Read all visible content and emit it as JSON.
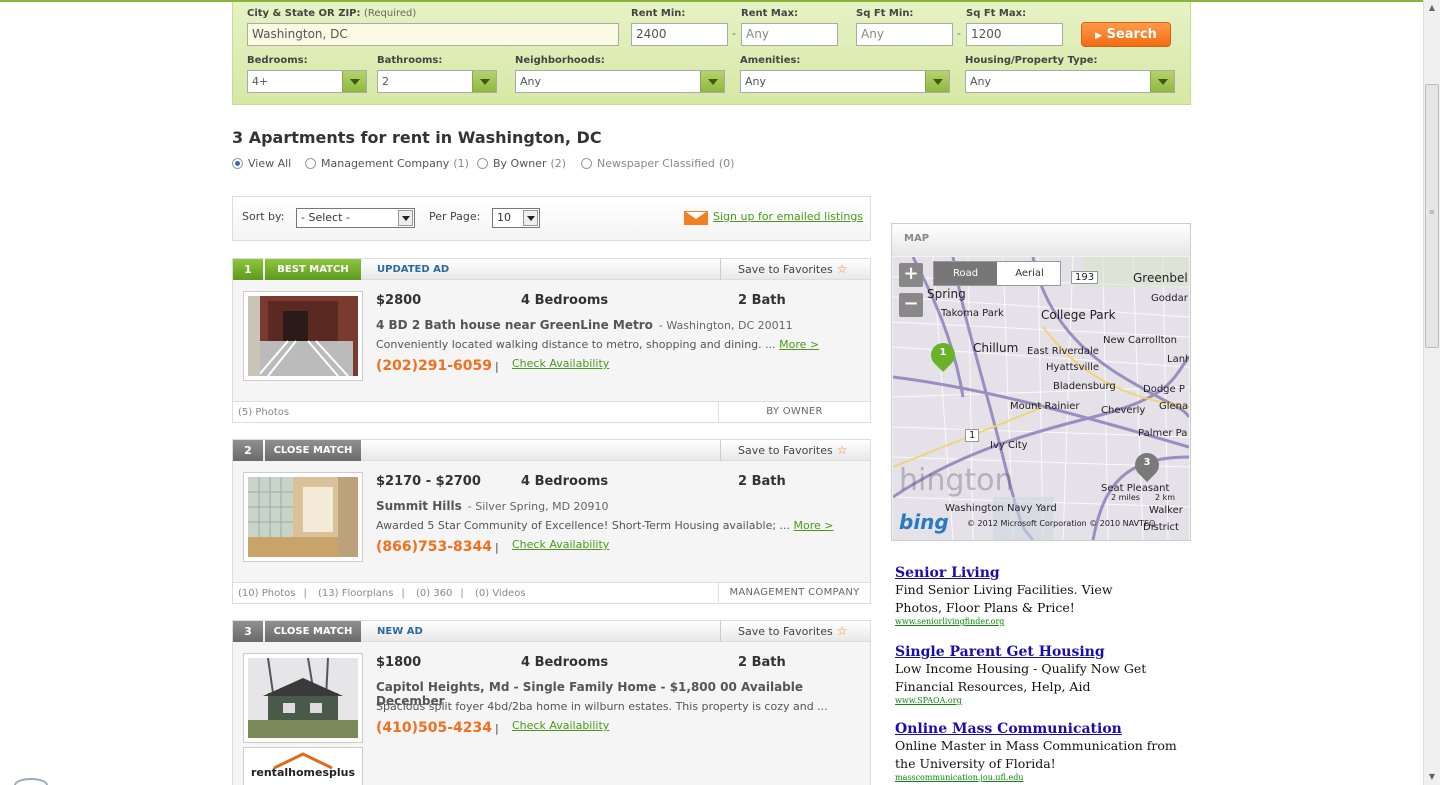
{
  "search": {
    "city_label": "City & State OR ZIP:",
    "city_required": "(Required)",
    "city_value": "Washington, DC",
    "rent_min_label": "Rent Min:",
    "rent_min_value": "2400",
    "rent_max_label": "Rent Max:",
    "rent_max_placeholder": "Any",
    "sqft_min_label": "Sq Ft Min:",
    "sqft_min_placeholder": "Any",
    "sqft_max_label": "Sq Ft Max:",
    "sqft_max_value": "1200",
    "dash": "-",
    "search_label": "Search",
    "bedrooms_label": "Bedrooms:",
    "bedrooms_value": "4+",
    "bathrooms_label": "Bathrooms:",
    "bathrooms_value": "2",
    "neighborhoods_label": "Neighborhoods:",
    "neighborhoods_value": "Any",
    "amenities_label": "Amenities:",
    "amenities_value": "Any",
    "housing_label": "Housing/Property Type:",
    "housing_value": "Any"
  },
  "results": {
    "heading": "3 Apartments for rent in Washington, DC",
    "filters": [
      {
        "label": "View All",
        "count": ""
      },
      {
        "label": "Management Company",
        "count": "(1)"
      },
      {
        "label": "By Owner",
        "count": "(2)"
      },
      {
        "label": "Newspaper Classified",
        "count": "(0)"
      }
    ]
  },
  "sortbar": {
    "sort_label": "Sort by:",
    "sort_value": "- Select -",
    "perpage_label": "Per Page:",
    "perpage_value": "10",
    "email_link": "Sign up for emailed listings"
  },
  "favorites_label": "Save to Favorites",
  "check_label": "Check Availability",
  "more_label": "More >",
  "listings": [
    {
      "num": "1",
      "match": "BEST MATCH",
      "tag": "UPDATED AD",
      "price": "$2800",
      "beds": "4 Bedrooms",
      "bath": "2 Bath",
      "title": "4 BD 2 Bath house near GreenLine Metro",
      "location": "- Washington, DC 20011",
      "desc": "Conveniently located walking distance to metro, shopping and dining. ...",
      "phone": "(202)291-6059",
      "photos": "(5) Photos",
      "floorplans": "",
      "tours": "",
      "videos": "",
      "type": "BY OWNER"
    },
    {
      "num": "2",
      "match": "CLOSE MATCH",
      "tag": "",
      "price": "$2170 - $2700",
      "beds": "4 Bedrooms",
      "bath": "2 Bath",
      "title": "Summit Hills",
      "location": "- Silver Spring, MD 20910",
      "desc": "Awarded 5 Star Community of Excellence! Short-Term Housing available; ...",
      "phone": "(866)753-8344",
      "photos": "(10) Photos",
      "floorplans": "(13) Floorplans",
      "tours": "(0) 360",
      "videos": "(0) Videos",
      "type": "MANAGEMENT COMPANY"
    },
    {
      "num": "3",
      "match": "CLOSE MATCH",
      "tag": "NEW AD",
      "price": "$1800",
      "beds": "4 Bedrooms",
      "bath": "2 Bath",
      "title": "Capitol Heights, Md - Single Family Home - $1,800 00 Available December",
      "location": "",
      "desc": "Spacious split foyer 4bd/2ba home in wilburn estates. This property is cozy and ...",
      "phone": "(410)505-4234",
      "logo": "rentalhomesplus"
    }
  ],
  "map": {
    "header": "MAP",
    "zoom_in": "+",
    "zoom_out": "−",
    "tab_road": "Road",
    "tab_aerial": "Aerial",
    "places": [
      "Greenbel",
      "Goddar",
      "Spring",
      "Takoma Park",
      "College Park",
      "Chillum",
      "East Riverdale",
      "New Carrollton",
      "Lanh",
      "Hyattsville",
      "Bladensburg",
      "Dodge P",
      "Mount Rainier",
      "Cheverly",
      "Glenar",
      "Palmer Pa",
      "Ivy City",
      "Seat Pleasant",
      "Walker",
      "District",
      "Washington Navy Yard",
      "hington"
    ],
    "routes": [
      "193",
      "1"
    ],
    "pins": [
      "1",
      "3"
    ],
    "scale_miles": "2 miles",
    "scale_km": "2 km",
    "brand": "bing",
    "copyright": "© 2012 Microsoft Corporation   © 2010 NAVTEQ"
  },
  "ads": [
    {
      "title": "Senior Living",
      "text": "Find Senior Living Facilities. View Photos, Floor Plans & Price!",
      "url": "www.seniorlivingfinder.org"
    },
    {
      "title": "Single Parent Get Housing",
      "text": "Low Income Housing - Qualify Now Get Financial Resources, Help, Aid",
      "url": "www.SPAOA.org"
    },
    {
      "title": "Online Mass Communication",
      "text": "Online Master in Mass Communication from the University of Florida!",
      "url": "masscommunication.jou.ufl.edu"
    }
  ],
  "colors": {
    "accent_green": "#8cc63e",
    "orange": "#f36c12",
    "link_green": "#4a9a1a"
  }
}
